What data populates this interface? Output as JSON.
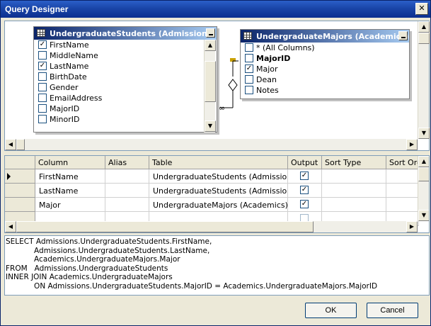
{
  "window": {
    "title": "Query Designer",
    "close_glyph": "✕"
  },
  "diagram": {
    "table1": {
      "title": "UndergraduateStudents (Admissions)",
      "columns": [
        {
          "label": "FirstName",
          "checked": true
        },
        {
          "label": "MiddleName",
          "checked": false
        },
        {
          "label": "LastName",
          "checked": true
        },
        {
          "label": "BirthDate",
          "checked": false
        },
        {
          "label": "Gender",
          "checked": false
        },
        {
          "label": "EmailAddress",
          "checked": false
        },
        {
          "label": "MajorID",
          "checked": false
        },
        {
          "label": "MinorID",
          "checked": false
        }
      ]
    },
    "table2": {
      "title": "UndergraduateMajors (Academics)",
      "columns": [
        {
          "label": "* (All Columns)",
          "checked": false
        },
        {
          "label": "MajorID",
          "checked": false,
          "bold": true
        },
        {
          "label": "Major",
          "checked": true
        },
        {
          "label": "Dean",
          "checked": false
        },
        {
          "label": "Notes",
          "checked": false
        }
      ]
    }
  },
  "grid": {
    "headers": [
      "Column",
      "Alias",
      "Table",
      "Output",
      "Sort Type",
      "Sort Order"
    ],
    "rows": [
      {
        "column": "FirstName",
        "alias": "",
        "table": "UndergraduateStudents (Admissions)",
        "output": true
      },
      {
        "column": "LastName",
        "alias": "",
        "table": "UndergraduateStudents (Admissions)",
        "output": true
      },
      {
        "column": "Major",
        "alias": "",
        "table": "UndergraduateMajors (Academics)",
        "output": true
      }
    ]
  },
  "sql": {
    "lines": [
      "SELECT Admissions.UndergraduateStudents.FirstName,",
      "            Admissions.UndergraduateStudents.LastName,",
      "            Academics.UndergraduateMajors.Major",
      "FROM   Admissions.UndergraduateStudents",
      "INNER JOIN Academics.UndergraduateMajors",
      "            ON Admissions.UndergraduateStudents.MajorID = Academics.UndergraduateMajors.MajorID"
    ]
  },
  "buttons": {
    "ok": "OK",
    "cancel": "Cancel"
  },
  "colors": {
    "title_bar": "#0b2f8f",
    "pane_border": "#7f9db9",
    "dialog_bg": "#ece9d8"
  }
}
